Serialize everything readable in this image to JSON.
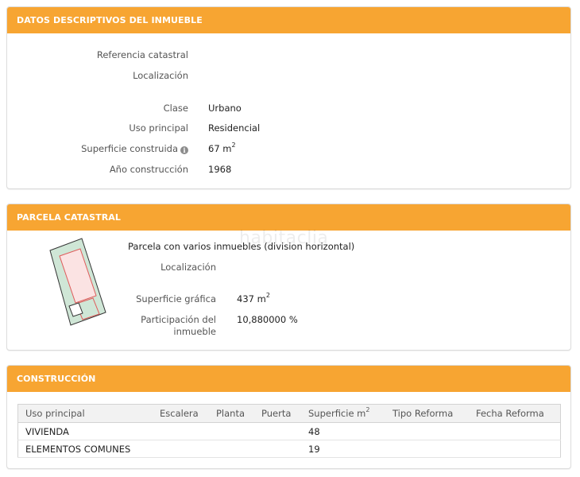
{
  "datos": {
    "title": "DATOS DESCRIPTIVOS DEL INMUEBLE",
    "labels": {
      "referencia": "Referencia catastral",
      "localizacion": "Localización",
      "clase": "Clase",
      "uso": "Uso principal",
      "superficie": "Superficie construida",
      "anio": "Año construcción"
    },
    "values": {
      "referencia": "",
      "localizacion": "",
      "clase": "Urbano",
      "uso": "Residencial",
      "superficie": "67 m",
      "superficie_exp": "2",
      "anio": "1968"
    },
    "info_icon": "info-icon"
  },
  "parcela": {
    "title": "PARCELA CATASTRAL",
    "description": "Parcela con varios inmuebles (division horizontal)",
    "labels": {
      "localizacion": "Localización",
      "superficie": "Superficie gráfica",
      "participacion_1": "Participación del",
      "participacion_2": "inmueble"
    },
    "values": {
      "localizacion": "",
      "superficie": "437 m",
      "superficie_exp": "2",
      "participacion": "10,880000 %"
    },
    "watermark": "habitaclia"
  },
  "construccion": {
    "title": "CONSTRUCCIÓN",
    "columns": [
      "Uso principal",
      "Escalera",
      "Planta",
      "Puerta",
      "Superficie m",
      "Tipo Reforma",
      "Fecha Reforma"
    ],
    "superficie_exp": "2",
    "rows": [
      [
        "VIVIENDA",
        "",
        "",
        "",
        "48",
        "",
        ""
      ],
      [
        "ELEMENTOS COMUNES",
        "",
        "",
        "",
        "19",
        "",
        ""
      ]
    ]
  },
  "colors": {
    "header_bg": "#f7a532",
    "header_text": "#ffffff",
    "parcel_fill": "#cfe6d6",
    "building_outline": "#e05a5a"
  }
}
